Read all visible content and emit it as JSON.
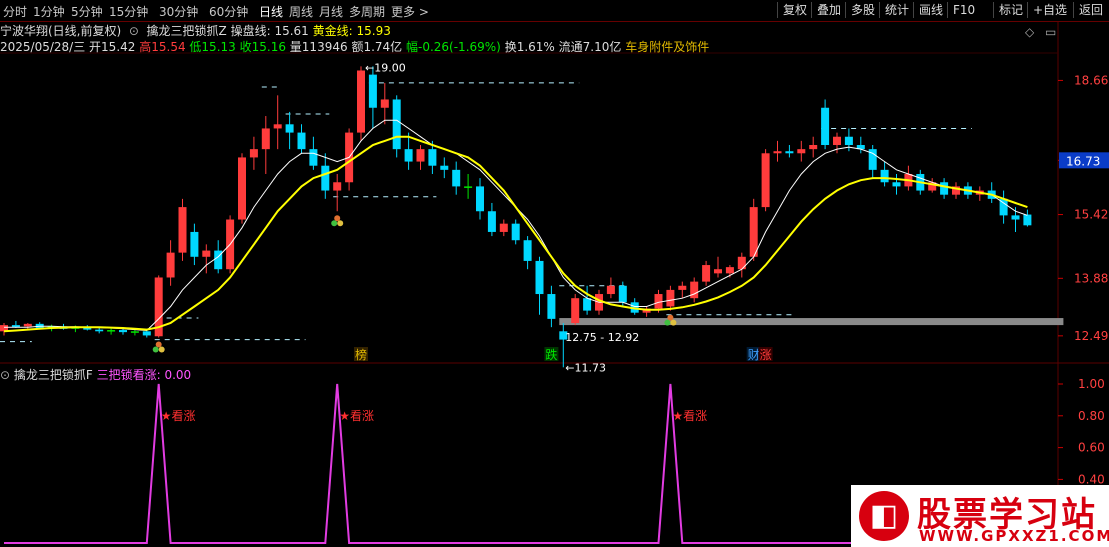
{
  "toolbar": {
    "left": [
      "分时",
      "1分钟",
      "5分钟",
      "15分钟",
      "30分钟",
      "60分钟",
      "日线",
      "周线",
      "月线",
      "多周期",
      "更多 >"
    ],
    "active_index": 6,
    "right": [
      "复权",
      "叠加",
      "多股",
      "统计",
      "画线",
      "F10",
      "标记",
      "+自选",
      "返回"
    ]
  },
  "info": {
    "stock": "宁波华翔(日线,前复权)",
    "indicator": "擒龙三把锁抓Z",
    "ops_label": "操盘线: 15.61",
    "gold_label": "黄金线: 15.93",
    "date": "2025/05/28/三",
    "open": "开15.42",
    "high": "高15.54",
    "low": "低15.13",
    "close": "收15.16",
    "volume": "量113946",
    "amount": "额1.74亿",
    "change": "幅-0.26(-1.69%)",
    "turnover": "换1.61%",
    "float": "流通7.10亿",
    "sector": "车身附件及饰件"
  },
  "sub": {
    "title": "擒龙三把锁抓F",
    "value_label": "三把锁看涨: 0.00",
    "signal_label": "★看涨"
  },
  "logo": {
    "t1": "股票学习站",
    "t2": "WWW.GPXXZ1.COM",
    "mark": "◧"
  },
  "colors": {
    "up": "#ff3c3c",
    "down": "#00d8ff",
    "doji": "#00e600",
    "yellow": "#ffff00",
    "white": "#ffffff",
    "magenta": "#e23ce2",
    "grid": "#5a0000"
  },
  "chart_data": [
    {
      "type": "candlestick",
      "ylim": [
        12.1,
        19.25
      ],
      "y_ticks": [
        12.49,
        13.88,
        15.42,
        16.73,
        18.66
      ],
      "current_price_label": "16.73",
      "annotations": {
        "max": "19.00",
        "min": "11.73",
        "range": "12.75 - 12.92",
        "markers": [
          "榜",
          "跌",
          "财",
          "涨"
        ]
      },
      "ohlc": [
        [
          12.6,
          12.8,
          12.5,
          12.75
        ],
        [
          12.75,
          12.85,
          12.68,
          12.7
        ],
        [
          12.72,
          12.8,
          12.62,
          12.78
        ],
        [
          12.78,
          12.82,
          12.65,
          12.68
        ],
        [
          12.7,
          12.76,
          12.6,
          12.72
        ],
        [
          12.72,
          12.78,
          12.64,
          12.66
        ],
        [
          12.66,
          12.74,
          12.58,
          12.7
        ],
        [
          12.7,
          12.75,
          12.62,
          12.64
        ],
        [
          12.64,
          12.7,
          12.55,
          12.6
        ],
        [
          12.6,
          12.68,
          12.52,
          12.63
        ],
        [
          12.63,
          12.68,
          12.52,
          12.58
        ],
        [
          12.58,
          12.65,
          12.5,
          12.6
        ],
        [
          12.6,
          12.64,
          12.45,
          12.5
        ],
        [
          12.48,
          13.95,
          12.45,
          13.9
        ],
        [
          13.9,
          14.8,
          13.7,
          14.5
        ],
        [
          14.5,
          15.8,
          14.3,
          15.6
        ],
        [
          15.0,
          15.2,
          14.2,
          14.4
        ],
        [
          14.4,
          14.7,
          14.0,
          14.55
        ],
        [
          14.55,
          14.8,
          14.0,
          14.1
        ],
        [
          14.1,
          15.4,
          14.0,
          15.3
        ],
        [
          15.3,
          16.9,
          15.2,
          16.8
        ],
        [
          16.8,
          17.3,
          16.5,
          17.0
        ],
        [
          17.0,
          17.8,
          16.4,
          17.5
        ],
        [
          17.5,
          18.3,
          17.0,
          17.6
        ],
        [
          17.6,
          17.9,
          17.0,
          17.4
        ],
        [
          17.4,
          17.6,
          16.9,
          17.0
        ],
        [
          17.0,
          17.3,
          16.5,
          16.6
        ],
        [
          16.6,
          16.9,
          15.8,
          16.0
        ],
        [
          16.0,
          16.4,
          15.5,
          16.2
        ],
        [
          16.2,
          17.5,
          16.0,
          17.4
        ],
        [
          17.4,
          19.0,
          17.2,
          18.9
        ],
        [
          18.8,
          19.0,
          17.5,
          18.0
        ],
        [
          18.0,
          18.6,
          17.6,
          18.2
        ],
        [
          18.2,
          18.3,
          16.8,
          17.0
        ],
        [
          17.0,
          17.4,
          16.5,
          16.7
        ],
        [
          16.7,
          17.1,
          16.5,
          17.0
        ],
        [
          17.0,
          17.2,
          16.4,
          16.6
        ],
        [
          16.6,
          16.8,
          16.3,
          16.5
        ],
        [
          16.5,
          16.7,
          15.9,
          16.1
        ],
        [
          16.1,
          16.4,
          15.8,
          16.1
        ],
        [
          16.1,
          16.3,
          15.3,
          15.5
        ],
        [
          15.5,
          15.7,
          14.9,
          15.0
        ],
        [
          15.0,
          15.3,
          14.9,
          15.2
        ],
        [
          15.2,
          15.3,
          14.7,
          14.8
        ],
        [
          14.8,
          14.9,
          14.1,
          14.3
        ],
        [
          14.3,
          14.4,
          13.0,
          13.5
        ],
        [
          13.5,
          13.7,
          12.7,
          12.9
        ],
        [
          12.6,
          12.8,
          11.73,
          12.4
        ],
        [
          12.8,
          13.5,
          12.75,
          13.4
        ],
        [
          13.4,
          13.7,
          13.0,
          13.1
        ],
        [
          13.1,
          13.6,
          13.0,
          13.5
        ],
        [
          13.5,
          13.9,
          13.4,
          13.7
        ],
        [
          13.7,
          13.8,
          13.2,
          13.3
        ],
        [
          13.3,
          13.4,
          13.0,
          13.05
        ],
        [
          13.05,
          13.2,
          12.95,
          13.15
        ],
        [
          13.15,
          13.6,
          13.05,
          13.5
        ],
        [
          13.2,
          13.7,
          13.1,
          13.6
        ],
        [
          13.6,
          13.8,
          13.4,
          13.7
        ],
        [
          13.4,
          13.9,
          13.3,
          13.8
        ],
        [
          13.8,
          14.3,
          13.7,
          14.2
        ],
        [
          14.0,
          14.4,
          13.9,
          14.1
        ],
        [
          14.0,
          14.2,
          13.9,
          14.15
        ],
        [
          14.1,
          14.5,
          13.9,
          14.4
        ],
        [
          14.4,
          15.8,
          14.3,
          15.6
        ],
        [
          15.6,
          17.0,
          15.5,
          16.9
        ],
        [
          16.9,
          17.2,
          16.7,
          16.95
        ],
        [
          16.95,
          17.1,
          16.8,
          16.9
        ],
        [
          16.9,
          17.2,
          16.7,
          17.0
        ],
        [
          17.0,
          17.3,
          16.8,
          17.1
        ],
        [
          18.0,
          18.2,
          17.0,
          17.1
        ],
        [
          17.1,
          17.4,
          16.9,
          17.3
        ],
        [
          17.3,
          17.5,
          16.95,
          17.1
        ],
        [
          17.1,
          17.3,
          16.9,
          17.0
        ],
        [
          17.0,
          17.1,
          16.3,
          16.5
        ],
        [
          16.5,
          16.7,
          16.1,
          16.2
        ],
        [
          16.2,
          16.4,
          15.9,
          16.1
        ],
        [
          16.1,
          16.6,
          16.0,
          16.4
        ],
        [
          16.4,
          16.5,
          15.9,
          16.0
        ],
        [
          16.0,
          16.3,
          15.95,
          16.2
        ],
        [
          16.2,
          16.3,
          15.8,
          15.9
        ],
        [
          15.9,
          16.2,
          15.8,
          16.1
        ],
        [
          16.1,
          16.2,
          15.8,
          15.9
        ],
        [
          15.9,
          16.1,
          15.75,
          16.0
        ],
        [
          16.0,
          16.2,
          15.7,
          15.8
        ],
        [
          15.8,
          16.0,
          15.2,
          15.4
        ],
        [
          15.4,
          15.6,
          15.0,
          15.3
        ],
        [
          15.42,
          15.54,
          15.13,
          15.16
        ]
      ],
      "white_line": [
        12.7,
        12.7,
        12.7,
        12.72,
        12.72,
        12.71,
        12.71,
        12.7,
        12.69,
        12.68,
        12.66,
        12.64,
        12.62,
        12.9,
        13.2,
        13.6,
        13.9,
        14.2,
        14.4,
        14.7,
        15.1,
        15.6,
        16.0,
        16.4,
        16.7,
        16.9,
        16.9,
        16.8,
        16.7,
        16.8,
        17.2,
        17.5,
        17.7,
        17.7,
        17.5,
        17.3,
        17.1,
        17.0,
        16.9,
        16.7,
        16.5,
        16.2,
        15.9,
        15.6,
        15.3,
        14.9,
        14.4,
        13.9,
        13.6,
        13.4,
        13.3,
        13.3,
        13.3,
        13.2,
        13.2,
        13.3,
        13.35,
        13.4,
        13.5,
        13.65,
        13.8,
        13.95,
        14.1,
        14.4,
        15.0,
        15.5,
        16.0,
        16.4,
        16.7,
        16.9,
        17.0,
        17.05,
        17.0,
        16.9,
        16.7,
        16.5,
        16.4,
        16.3,
        16.2,
        16.1,
        16.05,
        16.0,
        15.95,
        15.9,
        15.7,
        15.5,
        15.4
      ],
      "yellow_line": [
        12.6,
        12.62,
        12.64,
        12.66,
        12.68,
        12.69,
        12.7,
        12.7,
        12.7,
        12.69,
        12.68,
        12.66,
        12.64,
        12.7,
        12.8,
        13.0,
        13.2,
        13.4,
        13.6,
        13.9,
        14.3,
        14.7,
        15.1,
        15.5,
        15.8,
        16.1,
        16.3,
        16.4,
        16.5,
        16.7,
        16.9,
        17.1,
        17.2,
        17.3,
        17.3,
        17.2,
        17.1,
        17.0,
        16.9,
        16.8,
        16.6,
        16.3,
        16.0,
        15.6,
        15.2,
        14.8,
        14.4,
        14.0,
        13.7,
        13.5,
        13.35,
        13.25,
        13.2,
        13.15,
        13.12,
        13.12,
        13.14,
        13.18,
        13.24,
        13.32,
        13.42,
        13.55,
        13.7,
        13.9,
        14.2,
        14.55,
        14.9,
        15.25,
        15.55,
        15.8,
        16.0,
        16.15,
        16.25,
        16.3,
        16.3,
        16.28,
        16.25,
        16.2,
        16.15,
        16.1,
        16.05,
        16.0,
        15.95,
        15.9,
        15.8,
        15.7,
        15.6
      ],
      "dashed_levels": [
        {
          "from": 0,
          "to": 2,
          "y": 12.35
        },
        {
          "from": 13,
          "to": 25,
          "y": 12.4
        },
        {
          "from": 14,
          "to": 16,
          "y": 12.92
        },
        {
          "from": 22,
          "to": 23,
          "y": 18.5
        },
        {
          "from": 24,
          "to": 27,
          "y": 17.85
        },
        {
          "from": 28,
          "to": 36,
          "y": 15.85
        },
        {
          "from": 31,
          "to": 48,
          "y": 18.6
        },
        {
          "from": 47,
          "to": 52,
          "y": 13.7
        },
        {
          "from": 56,
          "to": 66,
          "y": 13.0
        },
        {
          "from": 69,
          "to": 81,
          "y": 17.5
        }
      ],
      "support_band": {
        "from": 47,
        "to": 86,
        "y_low": 12.75,
        "y_high": 12.92
      },
      "signal_bars": [
        13,
        28,
        56
      ]
    },
    {
      "type": "line",
      "ylim": [
        0,
        1.05
      ],
      "y_ticks": [
        1.0,
        0.8,
        0.6,
        0.4,
        0.2
      ],
      "y_tick_labels": [
        "1.00",
        "0.80",
        "0.60",
        "0.40",
        "0.20"
      ],
      "x": [
        0,
        12,
        13,
        14,
        27,
        28,
        29,
        55,
        56,
        57,
        86
      ],
      "values": [
        0,
        0,
        1,
        0,
        0,
        1,
        0,
        0,
        1,
        0,
        0
      ]
    }
  ]
}
